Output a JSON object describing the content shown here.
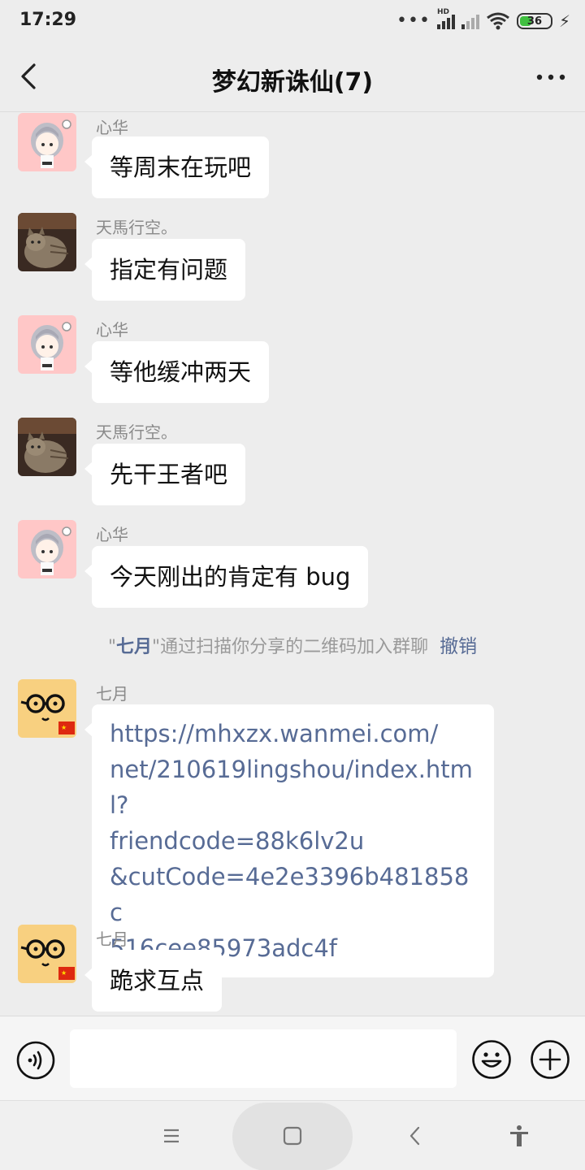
{
  "status_bar": {
    "time": "17:29",
    "network_label": "HD",
    "battery": "36"
  },
  "header": {
    "title": "梦幻新诛仙(7)"
  },
  "messages": [
    {
      "sender": "心华",
      "text": "等周末在玩吧",
      "avatar": "anime-girl-avatar"
    },
    {
      "sender": "天馬行空。",
      "text": "指定有问题",
      "avatar": "cat-photo-avatar"
    },
    {
      "sender": "心华",
      "text": "等他缓冲两天",
      "avatar": "anime-girl-avatar"
    },
    {
      "sender": "天馬行空。",
      "text": "先干王者吧",
      "avatar": "cat-photo-avatar"
    },
    {
      "sender": "心华",
      "text": "今天刚出的肯定有 bug",
      "avatar": "anime-girl-avatar"
    }
  ],
  "system_note": {
    "quote_open": "\"",
    "name": "七月",
    "quote_close": "\"",
    "text": "通过扫描你分享的二维码加入群聊",
    "action": "撤销"
  },
  "link_message": {
    "sender": "七月",
    "lines": [
      "https://mhxzx.wanmei.com/",
      "net/210619lingshou/index.html?",
      "friendcode=88k6lv2u",
      "&cutCode=4e2e3396b481858c",
      "516cee85973adc4f"
    ],
    "avatar": "glasses-cat-avatar"
  },
  "last_message": {
    "sender": "七月",
    "text": "跪求互点",
    "avatar": "glasses-cat-avatar"
  },
  "input_bar": {
    "value": "",
    "icons": [
      "voice-icon",
      "emoji-icon",
      "plus-icon"
    ]
  },
  "nav_bar": {
    "icons": [
      "menu-icon",
      "home-icon",
      "back-icon",
      "accessibility-icon"
    ]
  },
  "colors": {
    "background": "#ededed",
    "bubble": "#ffffff",
    "link": "#576b95",
    "sender": "#8a8a8a",
    "avatar_pink": "#ffc7c7"
  }
}
